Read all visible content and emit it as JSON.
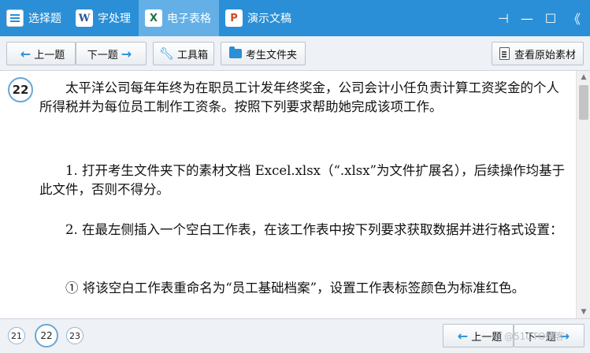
{
  "titlebar": {
    "tabs": [
      {
        "label": "选择题",
        "icon": "list-icon",
        "active": false
      },
      {
        "label": "字处理",
        "icon": "word-icon",
        "icon_text": "W",
        "active": false
      },
      {
        "label": "电子表格",
        "icon": "excel-icon",
        "icon_text": "X",
        "active": true
      },
      {
        "label": "演示文稿",
        "icon": "ppt-icon",
        "icon_text": "P",
        "active": false
      }
    ],
    "controls": [
      "pin-icon",
      "minimize-icon",
      "maximize-icon",
      "collapse-icon"
    ],
    "control_glyphs": [
      "⊣",
      "—",
      "☐",
      "《"
    ],
    "color": "#2a8fd6"
  },
  "toolbar": {
    "prev_label": "上一题",
    "next_label": "下一题",
    "tools_label": "工具箱",
    "folder_label": "考生文件夹",
    "view_original_label": "查看原始素材"
  },
  "question": {
    "number": "22",
    "paragraphs": [
      "太平洋公司每年年终为在职员工计发年终奖金，公司会计小任负责计算工资奖金的个人所得税并为每位员工制作工资条。按照下列要求帮助她完成该项工作。",
      "1. 打开考生文件夹下的素材文档 Excel.xlsx（“.xlsx”为文件扩展名），后续操作均基于此文件，否则不得分。",
      "2. 在最左侧插入一个空白工作表，在该工作表中按下列要求获取数据并进行格式设置：",
      "① 将该空白工作表重命名为“员工基础档案”，设置工作表标签颜色为标准红色。"
    ]
  },
  "bottom": {
    "nav_numbers": [
      "21",
      "22",
      "23"
    ],
    "current": "22",
    "prev_label": "上一题",
    "next_label": "下一题"
  },
  "watermark": "@51CTO博客"
}
